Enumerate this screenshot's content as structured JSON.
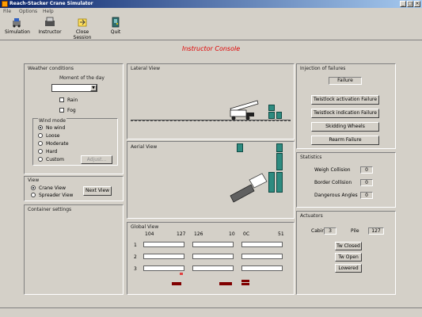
{
  "window": {
    "title": "Reach-Stacker Crane Simulator",
    "min": "_",
    "max": "□",
    "close": "×"
  },
  "menu": [
    "File",
    "Options",
    "Help"
  ],
  "toolbar": [
    {
      "label": "Simulation",
      "icon": "simulation-icon"
    },
    {
      "label": "Instructor",
      "icon": "instructor-icon"
    },
    {
      "label": "Close Session",
      "icon": "close-session-icon"
    },
    {
      "label": "Quit",
      "icon": "quit-icon"
    }
  ],
  "console_title": "Instructor Console",
  "weather": {
    "title": "Weather conditions",
    "moment_label": "Moment of the day",
    "moment_value": "",
    "rain": "Rain",
    "fog": "Fog",
    "wind_title": "Wind mode",
    "wind_options": [
      "No wind",
      "Loose",
      "Moderate",
      "Hard",
      "Custom"
    ],
    "wind_selected": 0,
    "adjust": "Adjust..."
  },
  "view": {
    "title": "View",
    "options": [
      "Crane View",
      "Spreader View"
    ],
    "selected": 0,
    "next": "Next View"
  },
  "container_settings": {
    "title": "Container settings"
  },
  "lateral_view": {
    "title": "Lateral View"
  },
  "aerial_view": {
    "title": "Aerial View"
  },
  "global_view": {
    "title": "Global View",
    "columns": [
      "104",
      "127",
      "126",
      "10",
      "0C",
      "51"
    ],
    "rows": [
      "1",
      "2",
      "3"
    ]
  },
  "failures": {
    "title": "Injection of failures",
    "status": "Failure",
    "buttons": [
      "Twistlock activation Failure",
      "Twistlock indication Failure",
      "Skidding Wheels",
      "Rearm Failure"
    ]
  },
  "statistics": {
    "title": "Statistics",
    "rows": [
      {
        "label": "Weigh Collision",
        "value": "0"
      },
      {
        "label": "Border Collision",
        "value": "0"
      },
      {
        "label": "Dangerous Angles",
        "value": "0"
      }
    ]
  },
  "actuators": {
    "title": "Actuators",
    "cabin_label": "Cabin",
    "cabin_value": "3",
    "pile_label": "Pile",
    "pile_value": "127",
    "buttons": [
      "Tw Closed",
      "Tw Open",
      "Lowered"
    ]
  },
  "colors": {
    "accent": "#e00000",
    "container": "#2e8b80",
    "marker": "#800000"
  }
}
